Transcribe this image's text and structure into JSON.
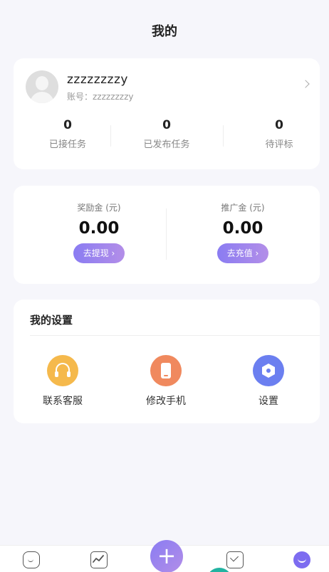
{
  "header": {
    "title": "我的"
  },
  "profile": {
    "username": "zzzzzzzzy",
    "account_label": "账号：zzzzzzzzy",
    "stats": [
      {
        "value": "0",
        "label": "已接任务"
      },
      {
        "value": "0",
        "label": "已发布任务"
      },
      {
        "value": "0",
        "label": "待评标"
      }
    ]
  },
  "funds": {
    "reward": {
      "label": "奖励金 (元)",
      "amount": "0.00",
      "button": "去提现 ›"
    },
    "promo": {
      "label": "推广金 (元)",
      "amount": "0.00",
      "button": "去充值 ›"
    }
  },
  "settings": {
    "title": "我的设置",
    "items": [
      {
        "label": "联系客服",
        "icon": "headset-icon"
      },
      {
        "label": "修改手机",
        "icon": "phone-icon"
      },
      {
        "label": "设置",
        "icon": "settings-icon"
      }
    ]
  },
  "bottom_nav": {
    "add_label": "+",
    "items": [
      "home-icon",
      "chart-icon",
      "add-icon",
      "message-icon",
      "profile-icon"
    ]
  },
  "colors": {
    "accent": "#8a7cf2",
    "service_icon": "#f5b94c",
    "phone_icon": "#f0895e",
    "settings_icon": "#6b7ff0",
    "background": "#f6f6fb"
  }
}
